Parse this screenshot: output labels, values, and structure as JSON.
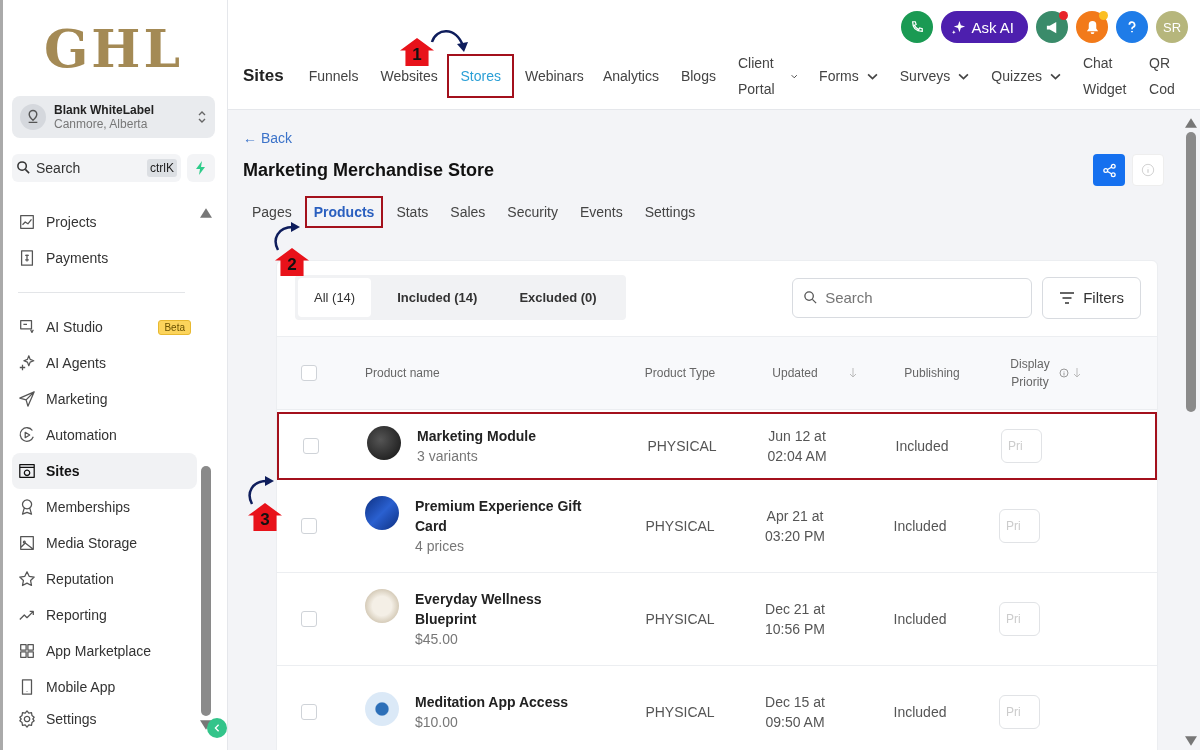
{
  "logo": "GHL",
  "account": {
    "name": "Blank WhiteLabel",
    "location": "Canmore, Alberta"
  },
  "sidebar_search": {
    "placeholder": "Search",
    "shortcut": "ctrlK"
  },
  "sidebar": {
    "items": [
      {
        "label": "Projects",
        "selected": false
      },
      {
        "label": "Payments",
        "selected": false
      },
      {
        "label": "AI Studio",
        "selected": false,
        "badge": "Beta"
      },
      {
        "label": "AI Agents",
        "selected": false
      },
      {
        "label": "Marketing",
        "selected": false
      },
      {
        "label": "Automation",
        "selected": false
      },
      {
        "label": "Sites",
        "selected": true
      },
      {
        "label": "Memberships",
        "selected": false
      },
      {
        "label": "Media Storage",
        "selected": false
      },
      {
        "label": "Reputation",
        "selected": false
      },
      {
        "label": "Reporting",
        "selected": false
      },
      {
        "label": "App Marketplace",
        "selected": false
      },
      {
        "label": "Mobile App",
        "selected": false
      },
      {
        "label": "Settings",
        "selected": false
      }
    ]
  },
  "top_bar": {
    "section": "Sites",
    "ask_ai": "Ask AI",
    "avatar": "SR"
  },
  "nav_tabs": [
    {
      "label": "Funnels",
      "selected": false,
      "dropdown": false,
      "highlighted": false
    },
    {
      "label": "Websites",
      "selected": false,
      "dropdown": false,
      "highlighted": false
    },
    {
      "label": "Stores",
      "selected": true,
      "dropdown": false,
      "highlighted": true
    },
    {
      "label": "Webinars",
      "selected": false,
      "dropdown": false,
      "highlighted": false
    },
    {
      "label": "Analytics",
      "selected": false,
      "dropdown": false,
      "highlighted": false
    },
    {
      "label": "Blogs",
      "selected": false,
      "dropdown": false,
      "highlighted": false
    },
    {
      "label": "Client Portal",
      "selected": false,
      "dropdown": true,
      "highlighted": false
    },
    {
      "label": "Forms",
      "selected": false,
      "dropdown": true,
      "highlighted": false
    },
    {
      "label": "Surveys",
      "selected": false,
      "dropdown": true,
      "highlighted": false
    },
    {
      "label": "Quizzes",
      "selected": false,
      "dropdown": true,
      "highlighted": false
    },
    {
      "label": "Chat Widget",
      "selected": false,
      "dropdown": false,
      "highlighted": false
    },
    {
      "label": "QR Cod",
      "selected": false,
      "dropdown": false,
      "highlighted": false
    }
  ],
  "page": {
    "back": "← Back",
    "title": "Marketing Merchandise Store"
  },
  "store_tabs": [
    {
      "label": "Pages",
      "selected": false,
      "highlighted": false
    },
    {
      "label": "Products",
      "selected": true,
      "highlighted": true
    },
    {
      "label": "Stats",
      "selected": false,
      "highlighted": false
    },
    {
      "label": "Sales",
      "selected": false,
      "highlighted": false
    },
    {
      "label": "Security",
      "selected": false,
      "highlighted": false
    },
    {
      "label": "Events",
      "selected": false,
      "highlighted": false
    },
    {
      "label": "Settings",
      "selected": false,
      "highlighted": false
    }
  ],
  "filter_tabs": [
    {
      "label": "All (14)",
      "selected": true
    },
    {
      "label": "Included (14)",
      "selected": false
    },
    {
      "label": "Excluded (0)",
      "selected": false
    }
  ],
  "product_search": {
    "placeholder": "Search"
  },
  "filters_button": "Filters",
  "table": {
    "select_all": {
      "checked": false
    },
    "columns": [
      "Product name",
      "Product Type",
      "Updated",
      "Publishing",
      "Display Priority"
    ],
    "rows": [
      {
        "name": "Marketing Module",
        "detail": "3 variants",
        "type": "PHYSICAL",
        "updated": "Jun 12 at 02:04 AM",
        "publishing": "Included",
        "priority_placeholder": "Pri",
        "checked": false,
        "highlighted": true
      },
      {
        "name": "Premium Experience Gift Card",
        "detail": "4 prices",
        "type": "PHYSICAL",
        "updated": "Apr 21 at 03:20 PM",
        "publishing": "Included",
        "priority_placeholder": "Pri",
        "checked": false,
        "highlighted": false
      },
      {
        "name": "Everyday Wellness Blueprint",
        "detail": "$45.00",
        "type": "PHYSICAL",
        "updated": "Dec 21 at 10:56 PM",
        "publishing": "Included",
        "priority_placeholder": "Pri",
        "checked": false,
        "highlighted": false
      },
      {
        "name": "Meditation App Access",
        "detail": "$10.00",
        "type": "PHYSICAL",
        "updated": "Dec 15 at 09:50 AM",
        "publishing": "Included",
        "priority_placeholder": "Pri",
        "checked": false,
        "highlighted": false
      }
    ]
  },
  "step_markers": [
    "1",
    "2",
    "3"
  ]
}
